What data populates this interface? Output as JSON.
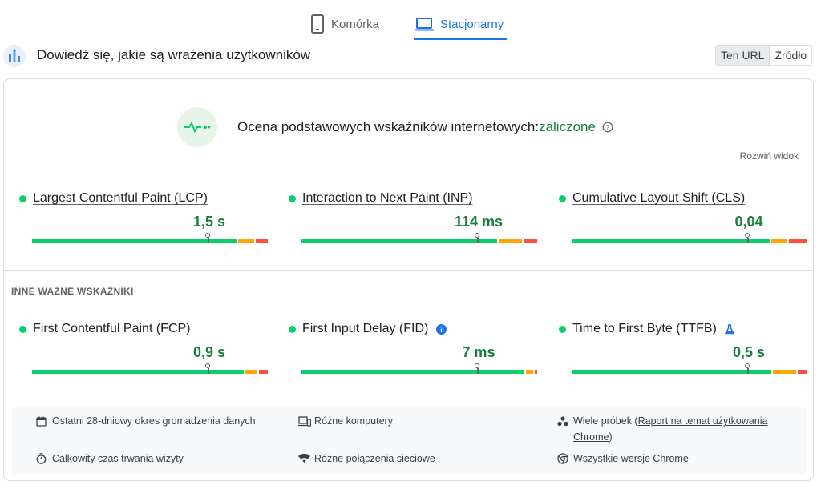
{
  "tabs": {
    "mobile_label": "Komórka",
    "desktop_label": "Stacjonarny",
    "active": "desktop"
  },
  "header": {
    "title": "Dowiedź się, jakie są wrażenia użytkowników",
    "toggle_url": "Ten URL",
    "toggle_origin": "Źródło",
    "active_toggle": "url"
  },
  "assessment": {
    "label": "Ocena podstawowych wskaźników internetowych:",
    "status": "zaliczone",
    "expand_label": "Rozwiń widok"
  },
  "core_metrics": [
    {
      "name": "Largest Contentful Paint (LCP)",
      "value": "1,5 s",
      "marker_fraction": 0.745,
      "distribution": {
        "good": 0.88,
        "ni": 0.07,
        "poor": 0.05
      }
    },
    {
      "name": "Interaction to Next Paint (INP)",
      "value": "114 ms",
      "marker_fraction": 0.745,
      "distribution": {
        "good": 0.84,
        "ni": 0.1,
        "poor": 0.06
      }
    },
    {
      "name": "Cumulative Layout Shift (CLS)",
      "value": "0,04",
      "marker_fraction": 0.745,
      "distribution": {
        "good": 0.85,
        "ni": 0.07,
        "poor": 0.08
      }
    }
  ],
  "other_section_label": "INNE WAŻNE WSKAŹNIKI",
  "other_metrics": [
    {
      "name": "First Contentful Paint (FCP)",
      "value": "0,9 s",
      "marker_fraction": 0.745,
      "distribution": {
        "good": 0.91,
        "ni": 0.05,
        "poor": 0.04
      },
      "extra_icon": ""
    },
    {
      "name": "First Input Delay (FID)",
      "value": "7 ms",
      "marker_fraction": 0.745,
      "distribution": {
        "good": 0.96,
        "ni": 0.03,
        "poor": 0.01
      },
      "extra_icon": "info-icon"
    },
    {
      "name": "Time to First Byte (TTFB)",
      "value": "0,5 s",
      "marker_fraction": 0.745,
      "distribution": {
        "good": 0.86,
        "ni": 0.1,
        "poor": 0.04
      },
      "extra_icon": "flask-icon"
    }
  ],
  "info": {
    "period": "Ostatni 28-dniowy okres gromadzenia danych",
    "devices": "Różne komputery",
    "samples_prefix": "Wiele próbek (",
    "samples_link": "Raport na temat użytkowania Chrome",
    "samples_suffix": ")",
    "duration": "Całkowity czas trwania wizyty",
    "network": "Różne połączenia sieciowe",
    "versions": "Wszystkie wersje Chrome"
  },
  "colors": {
    "good": "#0cce6b",
    "needs_improvement": "#ffa400",
    "poor": "#ff4e42",
    "accent": "#1a73e8",
    "pass_text": "#188038"
  }
}
